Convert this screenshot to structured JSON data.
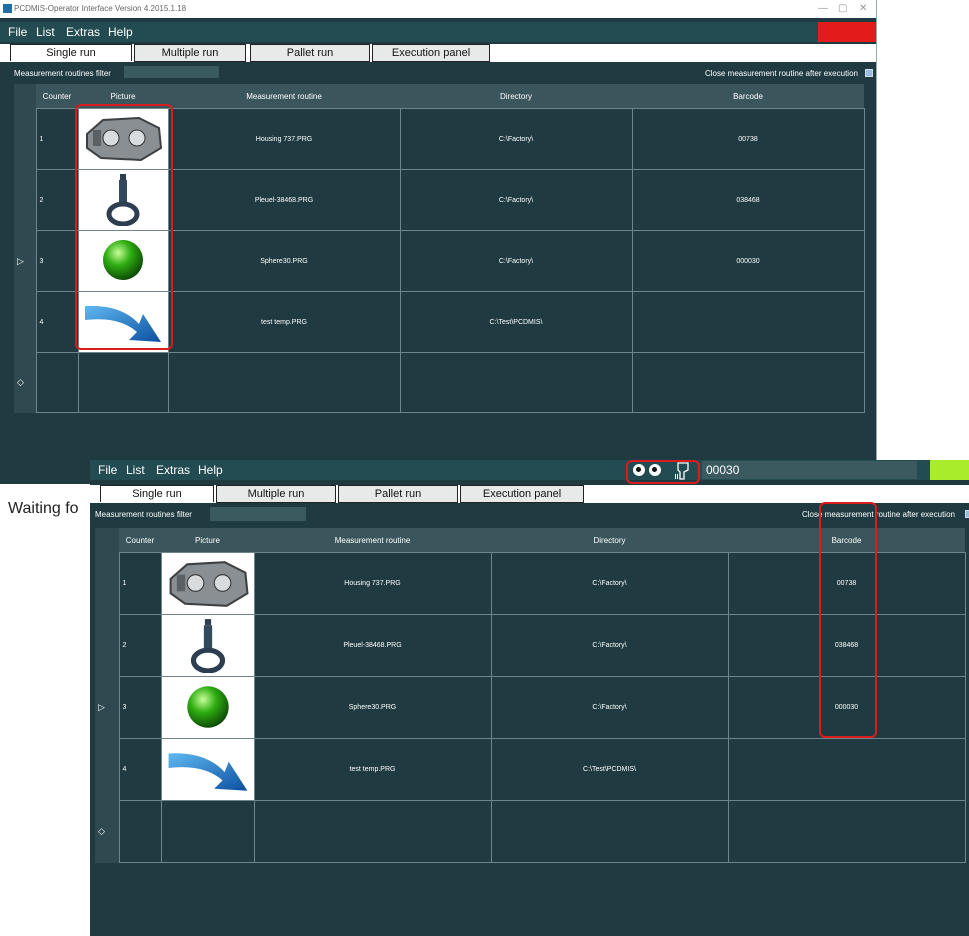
{
  "app": {
    "title": "PCDMIS-Operator Interface  Version 4.2015.1.18",
    "win_minimize": "—",
    "win_restore": "▢",
    "win_close": "✕"
  },
  "menu": {
    "file": "File",
    "list": "List",
    "extras": "Extras",
    "help": "Help"
  },
  "tabs": {
    "single": "Single run",
    "multiple": "Multiple run",
    "pallet": "Pallet run",
    "execution": "Execution panel"
  },
  "filter_label": "Measurement routines filter",
  "close_label": "Close measurement routine after execution",
  "columns": {
    "counter": "Counter",
    "picture": "Picture",
    "routine": "Measurement routine",
    "directory": "Directory",
    "barcode": "Barcode"
  },
  "rows": [
    {
      "counter": "1",
      "routine": "Housing 737.PRG",
      "directory": "C:\\Factory\\",
      "barcode": "00738",
      "picture": "housing-image"
    },
    {
      "counter": "2",
      "routine": "Pleuel-38468.PRG",
      "directory": "C:\\Factory\\",
      "barcode": "038468",
      "picture": "connecting-rod-image"
    },
    {
      "counter": "3",
      "routine": "Sphere30.PRG",
      "directory": "C:\\Factory\\",
      "barcode": "000030",
      "picture": "green-sphere-image"
    },
    {
      "counter": "4",
      "routine": "test temp.PRG",
      "directory": "C:\\Test\\PCDMIS\\",
      "barcode": "",
      "picture": "blue-arrow-image"
    }
  ],
  "row_header_current": "▷",
  "row_header_new": "◇",
  "status_text": "Waiting fo",
  "barcode_input_value": "00030",
  "colors": {
    "background": "#1f3b41",
    "menubar": "#234b52",
    "highlight_red": "#d91c1c",
    "status_green": "#a8ec2c"
  }
}
